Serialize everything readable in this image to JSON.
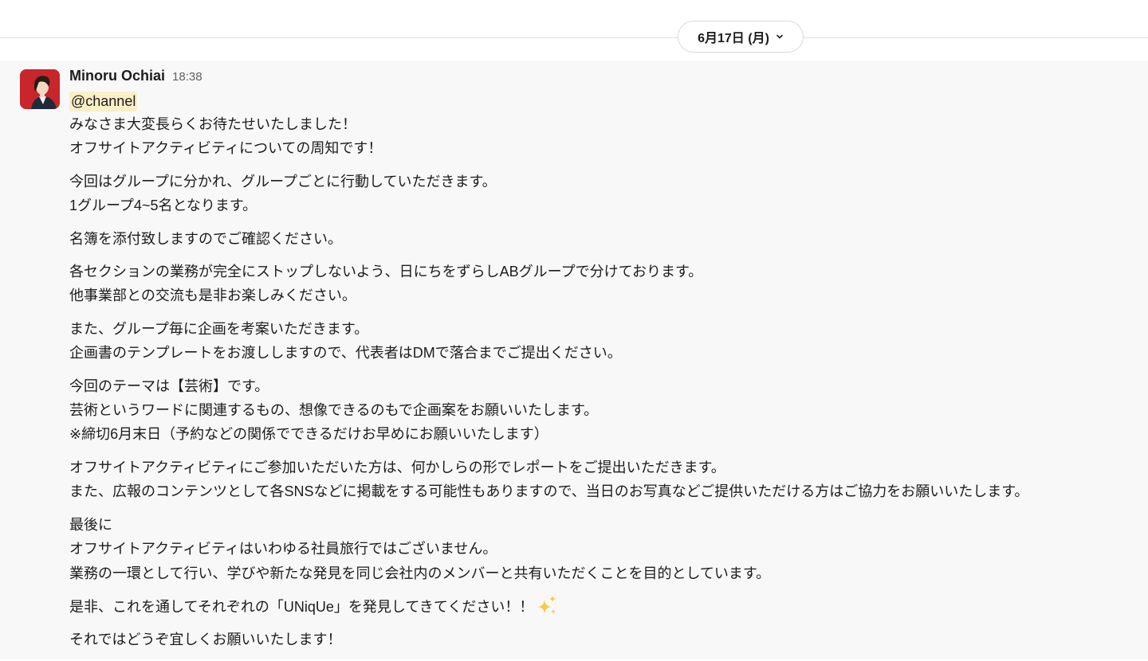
{
  "date_divider": {
    "label": "6月17日 (月)",
    "icon": "chevron-down-icon"
  },
  "message": {
    "sender": "Minoru Ochiai",
    "time": "18:38",
    "mention": "@channel",
    "paragraphs": [
      [
        "みなさま大変長らくお待たせいたしました！",
        "オフサイトアクティビティについての周知です！"
      ],
      [
        "今回はグループに分かれ、グループごとに行動していただきます。",
        "1グループ4~5名となります。"
      ],
      [
        "名簿を添付致しますのでご確認ください。"
      ],
      [
        "各セクションの業務が完全にストップしないよう、日にちをずらしABグループで分けております。",
        "他事業部との交流も是非お楽しみください。"
      ],
      [
        "また、グループ毎に企画を考案いただきます。",
        "企画書のテンプレートをお渡ししますので、代表者はDMで落合までご提出ください。"
      ],
      [
        "今回のテーマは【芸術】です。",
        "芸術というワードに関連するもの、想像できるのもで企画案をお願いいたします。",
        "※締切6月末日（予約などの関係でできるだけお早めにお願いいたします）"
      ],
      [
        "オフサイトアクティビティにご参加いただいた方は、何かしらの形でレポートをご提出いただきます。",
        "また、広報のコンテンツとして各SNSなどに掲載をする可能性もありますので、当日のお写真などご提供いただける方はご協力をお願いいたします。"
      ],
      [
        "最後に",
        "オフサイトアクティビティはいわゆる社員旅行ではございません。",
        "業務の一環として行い、学びや新たな発見を同じ会社内のメンバーと共有いただくことを目的としています。"
      ],
      [
        "是非、これを通してそれぞれの「UNiqUe」を発見してきてください！！"
      ],
      [
        "それではどうぞ宜しくお願いいたします！"
      ]
    ],
    "emoji": "sparkles-icon"
  },
  "colors": {
    "mention_bg": "#fbefc7",
    "message_bg": "#f8f8f8",
    "avatar_bg": "#c8262b"
  }
}
